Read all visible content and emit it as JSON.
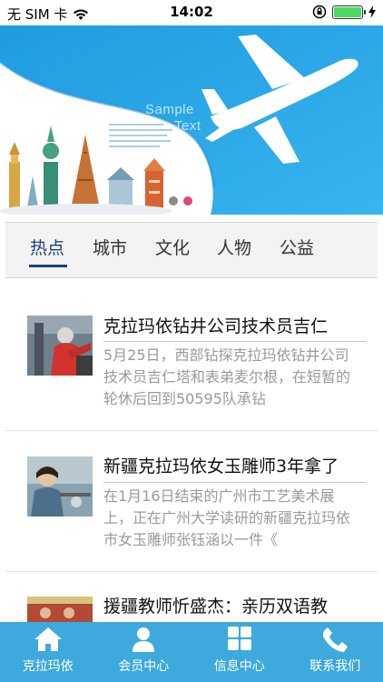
{
  "status_bar": {
    "carrier": "无 SIM 卡",
    "time": "14:02",
    "battery_level": 1.0
  },
  "banner": {
    "sample_text_line1": "Sample",
    "sample_text_line2": "Text",
    "page_indicator": {
      "count": 2,
      "active_index": 1
    }
  },
  "tabs": [
    {
      "label": "热点",
      "active": true
    },
    {
      "label": "城市",
      "active": false
    },
    {
      "label": "文化",
      "active": false
    },
    {
      "label": "人物",
      "active": false
    },
    {
      "label": "公益",
      "active": false
    }
  ],
  "news": [
    {
      "title": "克拉玛依钻井公司技术员吉仁",
      "summary": "5月25日，西部钻探克拉玛依钻井公司技术员吉仁塔和表弟麦尔根，在短暂的轮休后回到50595队承钻"
    },
    {
      "title": "新疆克拉玛依女玉雕师3年拿了",
      "summary": "在1月16日结束的广州市工艺美术展上，正在广州大学读研的新疆克拉玛依市女玉雕师张钰涵以一件《"
    },
    {
      "title": "援疆教师忻盛杰：亲历双语教",
      "summary": ""
    }
  ],
  "tabbar": [
    {
      "label": "克拉玛依",
      "icon": "home-icon"
    },
    {
      "label": "会员中心",
      "icon": "person-icon"
    },
    {
      "label": "信息中心",
      "icon": "grid-icon"
    },
    {
      "label": "联系我们",
      "icon": "phone-icon"
    }
  ],
  "colors": {
    "banner_blue": "#2aa8ea",
    "tab_active": "#1d3f80",
    "tabbar_bg": "#3ea9dc"
  }
}
